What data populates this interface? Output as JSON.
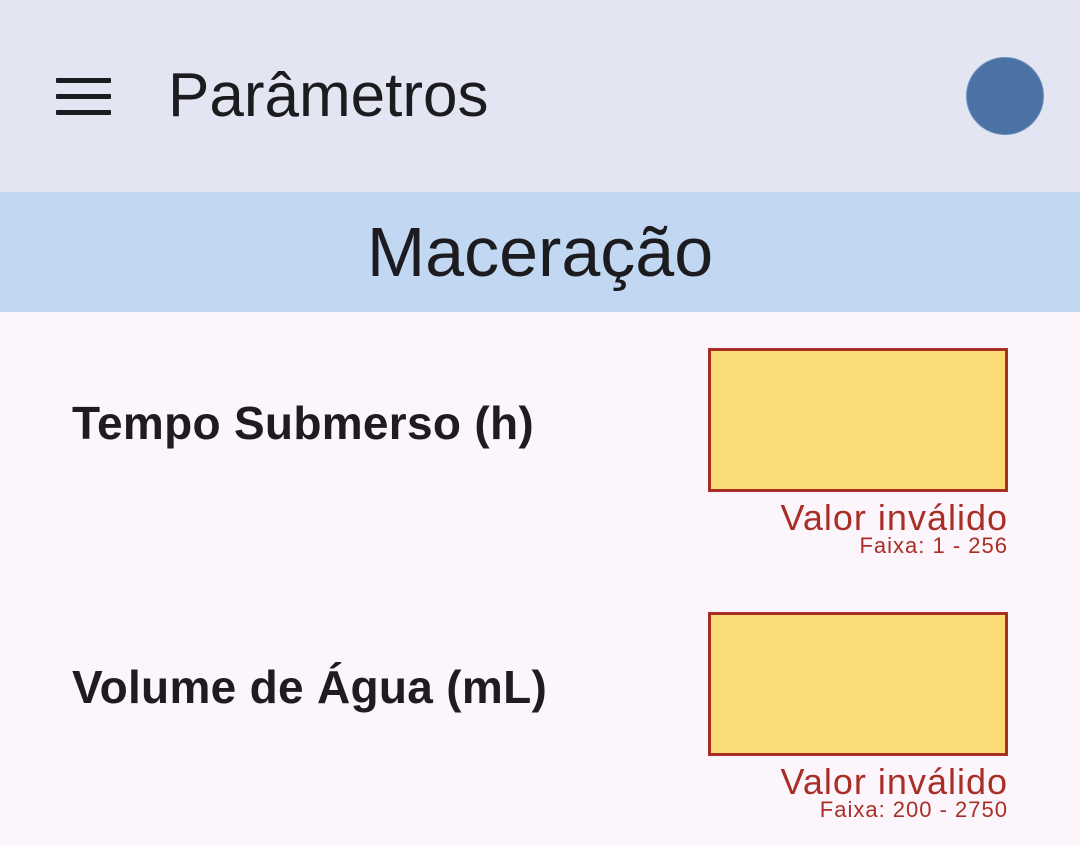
{
  "appbar": {
    "title": "Parâmetros",
    "menu_icon": "menu-icon",
    "avatar_color": "#4a72a4"
  },
  "section": {
    "title": "Maceração"
  },
  "fields": [
    {
      "label": "Tempo Submerso (h)",
      "value": "",
      "error": "Valor inválido",
      "range": "Faixa: 1 - 256"
    },
    {
      "label": "Volume de Água (mL)",
      "value": "",
      "error": "Valor inválido",
      "range": "Faixa: 200 - 2750"
    }
  ],
  "colors": {
    "appbar_bg": "#e3e5f2",
    "section_bg": "#c2d8f2",
    "page_bg": "#fcf6fc",
    "input_bg": "#fbdb75",
    "error": "#a92e25"
  }
}
